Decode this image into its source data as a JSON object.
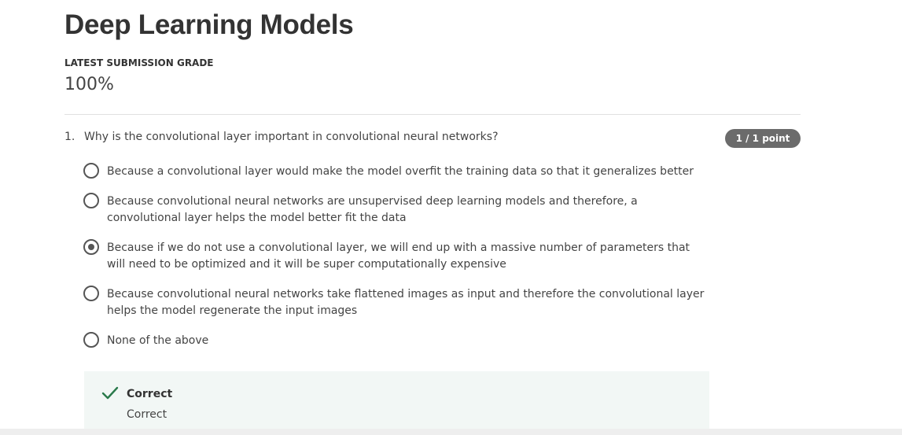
{
  "header": {
    "title": "Deep Learning Models",
    "grade_label": "LATEST SUBMISSION GRADE",
    "grade_value": "100%"
  },
  "question": {
    "number": "1.",
    "text": "Why is the convolutional layer important in convolutional neural networks?",
    "points": "1 / 1 point",
    "options": [
      {
        "label": "Because a convolutional layer would make the model overfit the training data so that it generalizes better",
        "selected": false
      },
      {
        "label": "Because convolutional neural networks are unsupervised deep learning models and therefore, a convolutional layer helps the model better fit the data",
        "selected": false
      },
      {
        "label": "Because if we do not use a convolutional layer, we will end up with a massive number of parameters that will need to be optimized and it will be super computationally expensive",
        "selected": true
      },
      {
        "label": "Because convolutional neural networks take flattened images as input and therefore the convolutional layer helps the model regenerate the input images",
        "selected": false
      },
      {
        "label": "None of the above",
        "selected": false
      }
    ]
  },
  "feedback": {
    "icon": "checkmark-icon",
    "title": "Correct",
    "text": "Correct",
    "color": "#2a7a4b"
  }
}
